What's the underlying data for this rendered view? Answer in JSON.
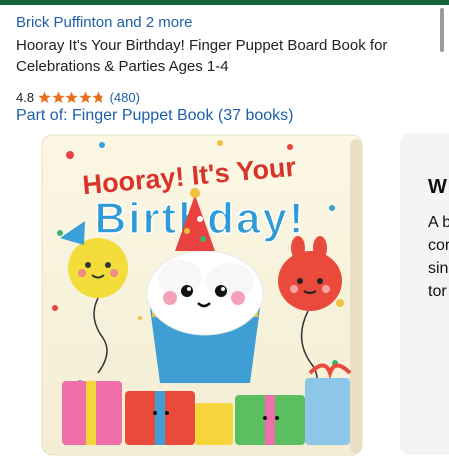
{
  "header": {
    "author_line": "Brick Puffinton and 2 more",
    "title": "Hooray It's Your Birthday! Finger Puppet Board Book for Celebrations & Parties Ages 1-4"
  },
  "rating": {
    "value": "4.8",
    "stars": 4.8,
    "star_color": "#e8711c",
    "reviews": "(480)"
  },
  "series": {
    "label": "Part of: Finger Puppet Book (37 books)"
  },
  "cover": {
    "title_line1": "Hooray! It's Your",
    "title_line2": "Birthday!"
  },
  "side_card": {
    "heading": "W",
    "lines": [
      "A b",
      "cor",
      "sin",
      "tor"
    ]
  },
  "colors": {
    "link": "#1f5fa8",
    "topbar": "#17653c"
  }
}
